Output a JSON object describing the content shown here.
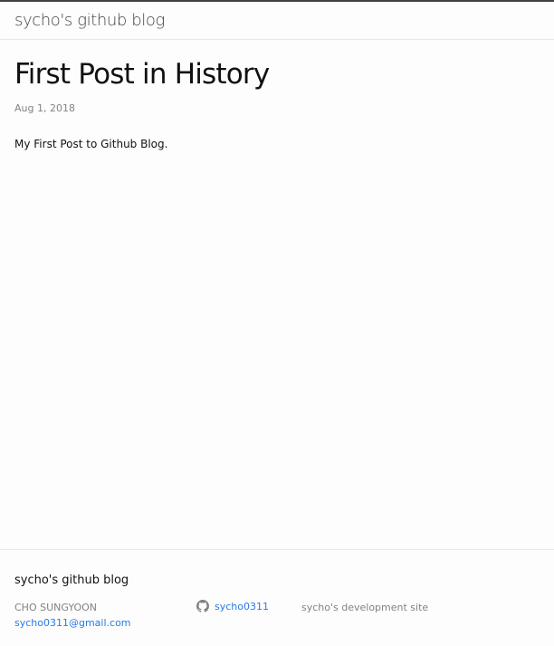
{
  "header": {
    "site_title": "sycho's github blog"
  },
  "post": {
    "title": "First Post in History",
    "date": "Aug 1, 2018",
    "content": "My First Post to Github Blog."
  },
  "footer": {
    "heading": "sycho's github blog",
    "author_name": "CHO SUNGYOON",
    "email": "sycho0311@gmail.com",
    "github_icon": "github-icon",
    "github_username": "sycho0311",
    "description": "sycho's development site"
  },
  "colors": {
    "background": "#fdfdfd",
    "text": "#111111",
    "muted": "#828282",
    "link": "#2a7ae2",
    "header_border": "#424242"
  }
}
